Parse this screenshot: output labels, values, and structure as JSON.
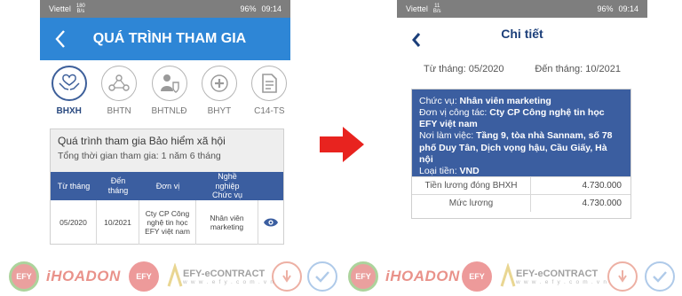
{
  "status_bar": {
    "carrier": "Viettel",
    "left_speed_top": "180",
    "right_speed_top": "11",
    "speed_unit": "B/s",
    "battery": "96%",
    "time": "09:14"
  },
  "left_screen": {
    "title": "QUÁ TRÌNH THAM GIA",
    "categories": [
      {
        "label": "BHXH",
        "icon": "hands-icon",
        "active": true
      },
      {
        "label": "BHTN",
        "icon": "people-network-icon",
        "active": false
      },
      {
        "label": "BHTNLĐ",
        "icon": "worker-shield-icon",
        "active": false
      },
      {
        "label": "BHYT",
        "icon": "medical-cross-icon",
        "active": false
      },
      {
        "label": "C14-TS",
        "icon": "document-icon",
        "active": false
      }
    ],
    "card": {
      "title": "Quá trình tham gia Bảo hiểm xã hội",
      "subtitle": "Tổng thời gian tham gia: 1 năm 6 tháng",
      "headers": [
        "Từ tháng",
        "Đến tháng",
        "Đơn vị",
        "Nghề nghiệp Chức vụ"
      ],
      "row": {
        "from": "05/2020",
        "to": "10/2021",
        "unit": "Cty CP Công nghệ tin học EFY việt nam",
        "job": "Nhân viên marketing"
      }
    }
  },
  "right_screen": {
    "title": "Chi tiết",
    "from_label": "Từ tháng: 05/2020",
    "to_label": "Đến tháng: 10/2021",
    "info": {
      "position_label": "Chức vụ: ",
      "position_value": "Nhân viên marketing",
      "company_label": "Đơn vị công tác: ",
      "company_value": "Cty CP Công nghệ tin học EFY việt nam",
      "workplace_label": "Nơi làm việc: ",
      "workplace_value": "Tầng 9, tòa nhà Sannam, số 78 phố Duy Tân, Dịch vọng hậu, Cầu Giấy, Hà nội",
      "currency_label": "Loại tiền: ",
      "currency_value": "VND"
    },
    "rows": [
      {
        "label": "Tiền lương đóng BHXH",
        "value": "4.730.000"
      },
      {
        "label": "Mức lương",
        "value": "4.730.000"
      }
    ]
  },
  "footer": {
    "logos": [
      {
        "text": "EFY",
        "icon": "efy-logo"
      },
      {
        "text": "iHOADON",
        "icon": "ihoadon-logo"
      },
      {
        "text": "EFY",
        "icon": "efy-red-logo"
      },
      {
        "text": "EFY-eCONTRACT",
        "sub": "w w w . e f y . c o m . v n",
        "icon": "econtract-logo"
      },
      {
        "text": "",
        "icon": "hand-logo"
      },
      {
        "text": "",
        "icon": "check-logo"
      }
    ]
  },
  "colors": {
    "header_blue": "#2e86d6",
    "table_blue": "#3b5ea0",
    "arrow_red": "#e8231f"
  }
}
